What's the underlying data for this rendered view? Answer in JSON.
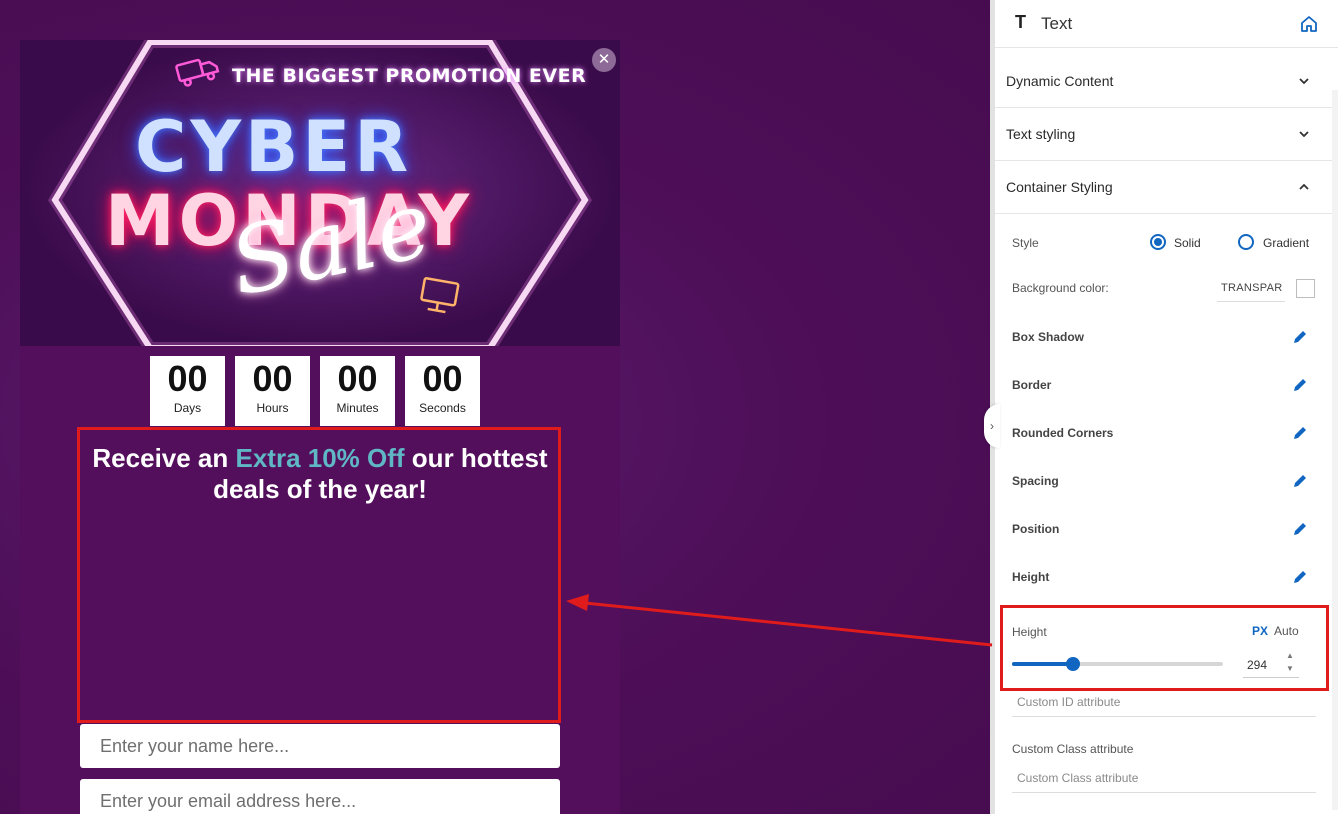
{
  "popup": {
    "close_symbol": "✕",
    "hero": {
      "promo_line": "THE BIGGEST PROMOTION EVER",
      "word1": "CYBER",
      "word2": "MONDAY",
      "word3": "Sale"
    },
    "countdown": [
      {
        "value": "00",
        "label": "Days"
      },
      {
        "value": "00",
        "label": "Hours"
      },
      {
        "value": "00",
        "label": "Minutes"
      },
      {
        "value": "00",
        "label": "Seconds"
      }
    ],
    "headline": {
      "prefix": "Receive an ",
      "accent": "Extra 10% Off",
      "suffix": " our hottest deals of the year!",
      "accent_color": "#5fb6c4"
    },
    "name_placeholder": "Enter your name here...",
    "email_placeholder": "Enter your email address here..."
  },
  "panel": {
    "title": "Text",
    "sections": {
      "dynamic_content": "Dynamic Content",
      "text_styling": "Text styling",
      "container_styling": "Container Styling"
    },
    "style_label": "Style",
    "style_options": {
      "solid": "Solid",
      "gradient": "Gradient"
    },
    "style_selected": "Solid",
    "background_label": "Background color:",
    "background_value": "TRANSPAR",
    "box_shadow": "Box Shadow",
    "border": "Border",
    "rounded_corners": "Rounded Corners",
    "spacing": "Spacing",
    "position": "Position",
    "height_section": "Height",
    "height": {
      "label": "Height",
      "unit_px": "PX",
      "unit_auto": "Auto",
      "value": "294",
      "slider_fraction": 0.29
    },
    "custom_id_placeholder": "Custom ID attribute",
    "custom_class_label": "Custom Class attribute",
    "custom_class_placeholder": "Custom Class attribute"
  },
  "colors": {
    "accent": "#1066c0",
    "highlight": "#e01b1b",
    "popup_bg": "#540f5c"
  },
  "icons": [
    "text-t-icon",
    "home-icon",
    "chevron-down-icon",
    "chevron-up-icon",
    "pencil-icon",
    "close-icon",
    "chevron-right-icon"
  ]
}
